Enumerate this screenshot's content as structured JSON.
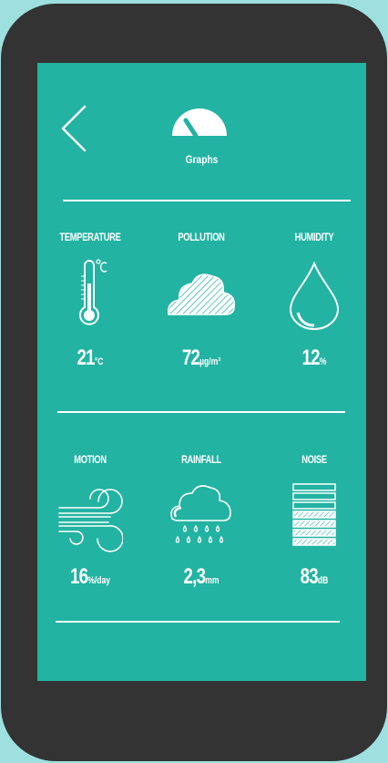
{
  "header": {
    "title": "Graphs",
    "back_icon": "chevron-left-icon",
    "gauge_icon": "gauge-icon"
  },
  "colors": {
    "background": "#9ee0e0",
    "device": "#333333",
    "screen": "#22b3a2",
    "foreground": "#ffffff"
  },
  "metrics": [
    {
      "label": "TEMPERATURE",
      "value": "21",
      "unit": "°C",
      "icon": "thermometer-icon"
    },
    {
      "label": "POLLUTION",
      "value": "72",
      "unit": "µg/m³",
      "icon": "cloud-icon"
    },
    {
      "label": "HUMIDITY",
      "value": "12",
      "unit": "%",
      "icon": "water-drop-icon"
    },
    {
      "label": "MOTION",
      "value": "16",
      "unit": "%/day",
      "icon": "wind-icon"
    },
    {
      "label": "RAINFALL",
      "value": "2,3",
      "unit": "mm",
      "icon": "rain-cloud-icon"
    },
    {
      "label": "NOISE",
      "value": "83",
      "unit": "dB",
      "icon": "noise-bars-icon"
    }
  ]
}
